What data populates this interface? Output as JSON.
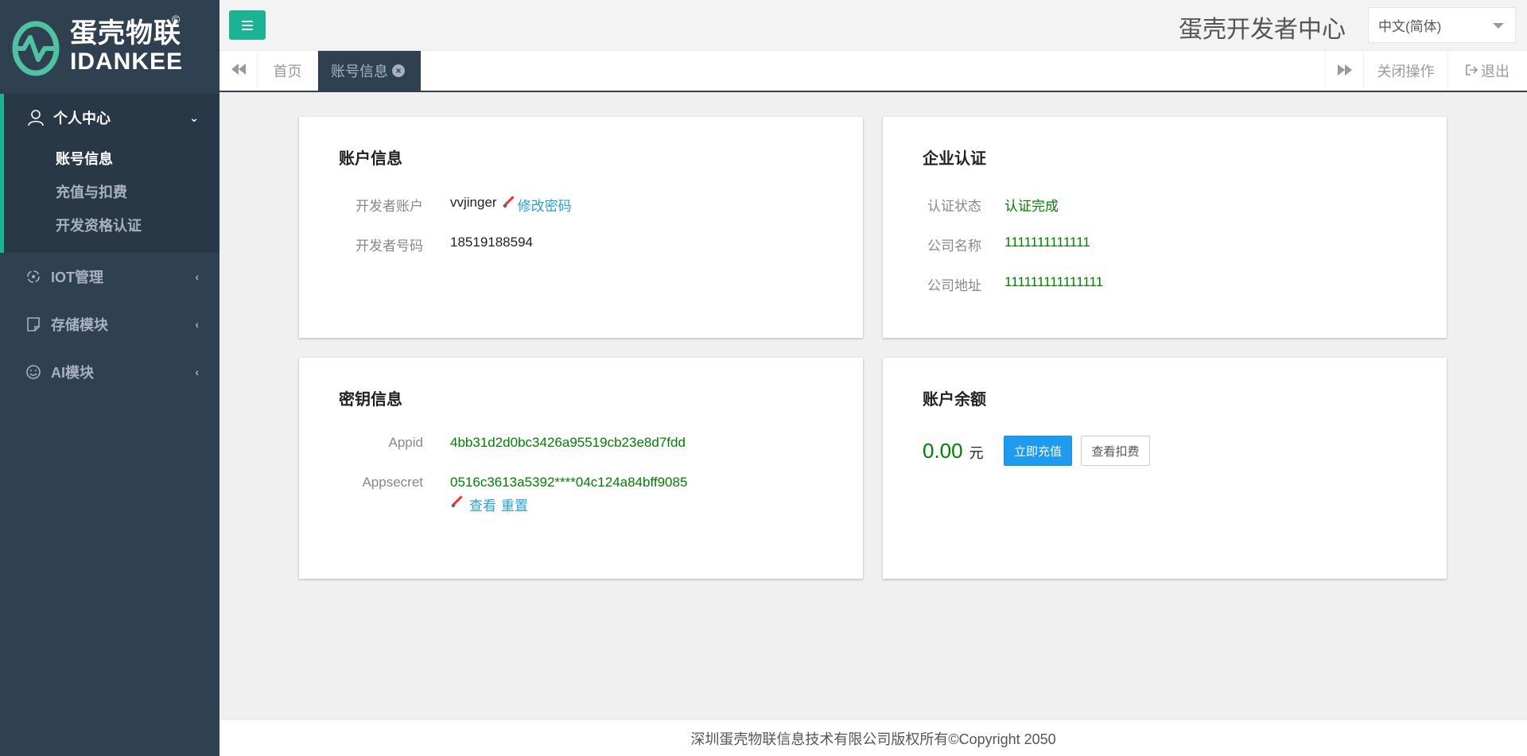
{
  "brand": {
    "cn": "蛋壳物联",
    "en": "IDANKEE",
    "mark": "©"
  },
  "header": {
    "title": "蛋壳开发者中心",
    "language": "中文(简体)"
  },
  "sidebar": {
    "groups": [
      {
        "label": "个人中心",
        "icon": "user-icon",
        "expanded": true,
        "items": [
          "账号信息",
          "充值与扣费",
          "开发资格认证"
        ]
      },
      {
        "label": "IOT管理",
        "icon": "iot-icon"
      },
      {
        "label": "存储模块",
        "icon": "storage-icon"
      },
      {
        "label": "AI模块",
        "icon": "smile-icon"
      }
    ]
  },
  "tabs": {
    "home": "首页",
    "active": "账号信息",
    "close_ops": "关闭操作",
    "logout": "退出"
  },
  "account": {
    "title": "账户信息",
    "dev_account_label": "开发者账户",
    "dev_account_value": "vvjinger",
    "change_password": "修改密码",
    "dev_phone_label": "开发者号码",
    "dev_phone_value": "18519188594"
  },
  "enterprise": {
    "title": "企业认证",
    "status_label": "认证状态",
    "status_value": "认证完成",
    "company_label": "公司名称",
    "company_value": "1111111111111",
    "address_label": "公司地址",
    "address_value": "111111111111111"
  },
  "keys": {
    "title": "密钥信息",
    "appid_label": "Appid",
    "appid_value": "4bb31d2d0bc3426a95519cb23e8d7fdd",
    "secret_label": "Appsecret",
    "secret_value": "0516c3613a5392****04c124a84bff9085",
    "view": "查看",
    "reset": "重置"
  },
  "balance": {
    "title": "账户余额",
    "amount": "0.00",
    "unit": "元",
    "recharge": "立即充值",
    "view_fees": "查看扣费"
  },
  "footer": "深圳蛋壳物联信息技术有限公司版权所有©Copyright 2050",
  "colors": {
    "sidebar": "#2f4050",
    "accent": "#1ab394",
    "link": "#23a0e8",
    "success": "#008000"
  }
}
